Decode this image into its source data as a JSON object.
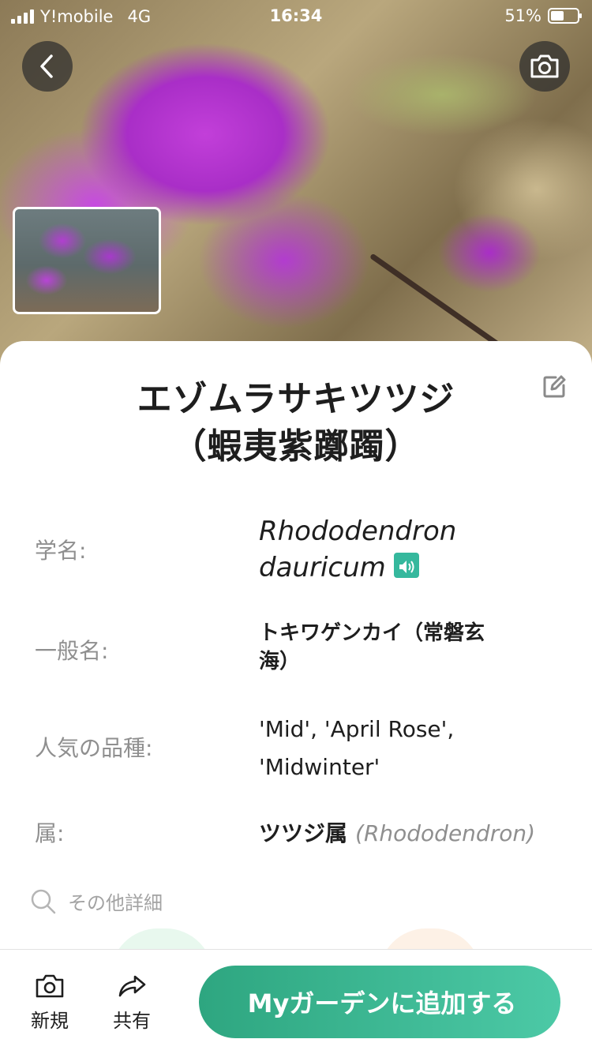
{
  "status_bar": {
    "carrier": "Y!mobile",
    "network": "4G",
    "time": "16:34",
    "battery": "51%"
  },
  "plant": {
    "title_line1": "エゾムラサキツツジ",
    "title_line2": "（蝦夷紫躑躅）"
  },
  "details": {
    "scientific_name": {
      "label": "学名:",
      "line1": "Rhododendron",
      "line2": "dauricum"
    },
    "common_name": {
      "label": "一般名:",
      "line1": "トキワゲンカイ（常磐玄",
      "line2": "海）"
    },
    "cultivars": {
      "label": "人気の品種:",
      "line1": "'Mid', 'April Rose',",
      "line2": "'Midwinter'"
    },
    "genus": {
      "label": "属:",
      "name_jp": "ツツジ属",
      "name_latin": "(Rhododendron)"
    }
  },
  "more_details": "その他詳細",
  "bottom_bar": {
    "new_label": "新規",
    "share_label": "共有",
    "add_button": "Myガーデンに追加する"
  },
  "colors": {
    "accent": "#35b89d",
    "cta_start": "#2ea680",
    "cta_end": "#4cc9a6"
  },
  "icons": [
    "back-icon",
    "camera-icon",
    "edit-icon",
    "sound-icon",
    "search-icon",
    "share-icon"
  ]
}
